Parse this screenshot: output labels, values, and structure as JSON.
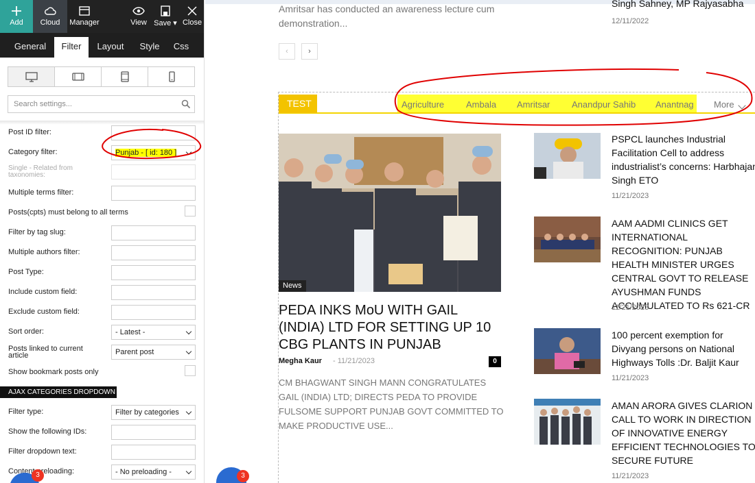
{
  "toolbar": {
    "add": "Add",
    "cloud": "Cloud",
    "manager": "Manager",
    "view": "View",
    "save": "Save",
    "close": "Close"
  },
  "tabs": [
    "General",
    "Filter",
    "Layout",
    "Style",
    "Css"
  ],
  "search": {
    "placeholder": "Search settings..."
  },
  "filters": [
    {
      "label": "Post ID filter:",
      "value": ""
    },
    {
      "label": "Category filter:",
      "value": "Punjab - [ id: 180 ]"
    },
    {
      "label": "Single - Related from taxonomies:",
      "value": ""
    },
    {
      "label": "Multiple terms filter:",
      "value": ""
    },
    {
      "label": "Posts(cpts) must belong to all terms",
      "value": ""
    },
    {
      "label": "Filter by tag slug:",
      "value": ""
    },
    {
      "label": "Multiple authors filter:",
      "value": ""
    },
    {
      "label": "Post Type:",
      "value": ""
    },
    {
      "label": "Include custom field:",
      "value": ""
    },
    {
      "label": "Exclude custom field:",
      "value": ""
    },
    {
      "label": "Sort order:",
      "value": "- Latest -"
    },
    {
      "label": "Posts linked to current article",
      "value": "Parent post"
    },
    {
      "label": "Show bookmark posts only",
      "value": ""
    }
  ],
  "ajax": {
    "header": "AJAX CATEGORIES DROPDOWN",
    "rows": [
      {
        "label": "Filter type:",
        "value": "Filter by categories"
      },
      {
        "label": "Show the following IDs:",
        "value": ""
      },
      {
        "label": "Filter dropdown text:",
        "value": ""
      },
      {
        "label": "Content preloading:",
        "value": "- No preloading -"
      }
    ]
  },
  "badges": [
    "3",
    "3"
  ],
  "site": {
    "prev_excerpt": "Amritsar has conducted an awareness lecture cum demonstration...",
    "prev_side_title": "Singh Sahney, MP Rajyasabha",
    "prev_side_date": "12/11/2022",
    "block_title": "TEST",
    "categories": [
      "Agriculture",
      "Ambala",
      "Amritsar",
      "Anandpur Sahib",
      "Anantnag"
    ],
    "more": "More",
    "main": {
      "tag": "News",
      "title": "PEDA INKS MoU WITH GAIL (INDIA) LTD FOR SETTING UP 10 CBG PLANTS IN PUNJAB",
      "author": "Megha Kaur",
      "date": "11/21/2023",
      "comments": "0",
      "excerpt": "CM BHAGWANT SINGH MANN CONGRATULATES GAIL (INDIA) LTD; DIRECTS PEDA TO PROVIDE FULSOME SUPPORT PUNJAB GOVT COMMITTED TO MAKE PRODUCTIVE USE..."
    },
    "side": [
      {
        "title": "PSPCL launches Industrial Facilitation Cell to address industrialist’s concerns: Harbhajan Singh ETO",
        "date": "11/21/2023"
      },
      {
        "title": "AAM AADMI CLINICS GET INTERNATIONAL RECOGNITION: PUNJAB HEALTH MINISTER URGES CENTRAL GOVT TO RELEASE AYUSHMAN FUNDS ACCUMULATED TO Rs 621-CR",
        "date": "11/21/2023"
      },
      {
        "title": "100 percent exemption for Divyang persons on National Highways Tolls :Dr. Baljit Kaur",
        "date": "11/21/2023"
      },
      {
        "title": "AMAN ARORA GIVES CLARION CALL TO WORK IN DIRECTION OF INNOVATIVE ENERGY EFFICIENT TECHNOLOGIES TO SECURE FUTURE",
        "date": "11/21/2023"
      }
    ]
  },
  "colors": {
    "accent_teal": "#2fa39a",
    "block_yellow": "#f3c300",
    "highlight": "#ffff00",
    "annotation_red": "#e00000"
  }
}
